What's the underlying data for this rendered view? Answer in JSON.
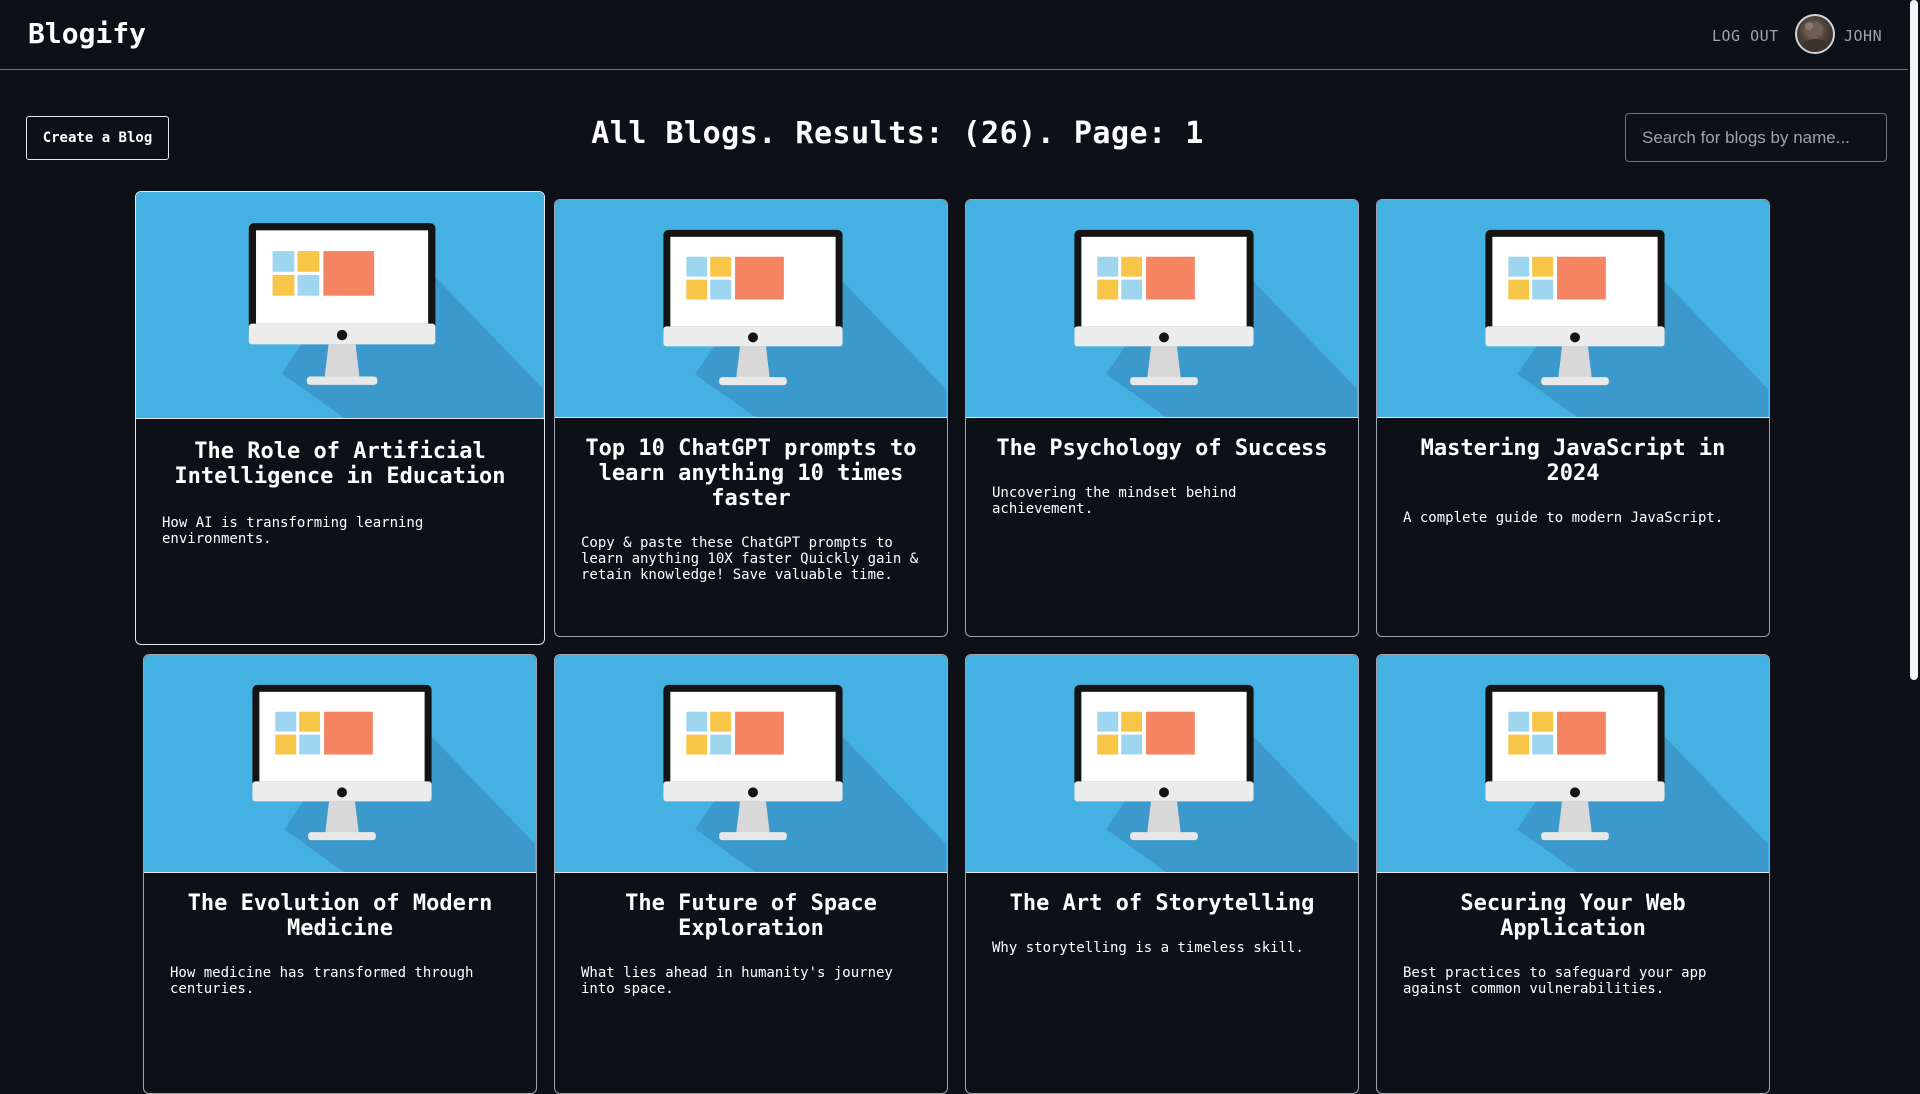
{
  "header": {
    "brand": "Blogify",
    "logout_label": "LOG OUT",
    "username": "JOHN"
  },
  "toolbar": {
    "create_label": "Create a Blog",
    "heading": "All Blogs. Results: (26). Page: 1",
    "search_placeholder": "Search for blogs by name..."
  },
  "icons": {
    "thumbnail": "desktop-monitor-illustration",
    "avatar": "user-avatar-photo"
  },
  "colors": {
    "background": "#0d1117",
    "thumbnail_bg": "#45b0e2",
    "text": "#ffffff",
    "muted_text": "#9ca3af"
  },
  "blogs": [
    {
      "title": "The Role of Artificial Intelligence in Education",
      "description": "How AI is transforming learning environments."
    },
    {
      "title": "Top 10 ChatGPT prompts to learn anything 10 times faster",
      "description": "Copy & paste these ChatGPT prompts to learn anything 10X faster  Quickly gain & retain knowledge! Save valuable time."
    },
    {
      "title": "The Psychology of Success",
      "description": "Uncovering the mindset behind achievement."
    },
    {
      "title": "Mastering JavaScript in 2024",
      "description": "A complete guide to modern JavaScript."
    },
    {
      "title": "The Evolution of Modern Medicine",
      "description": "How medicine has transformed through centuries."
    },
    {
      "title": "The Future of Space Exploration",
      "description": "What lies ahead in humanity's journey into space."
    },
    {
      "title": "The Art of Storytelling",
      "description": "Why storytelling is a timeless skill."
    },
    {
      "title": "Securing Your Web Application",
      "description": "Best practices to safeguard your app against common vulnerabilities."
    }
  ]
}
